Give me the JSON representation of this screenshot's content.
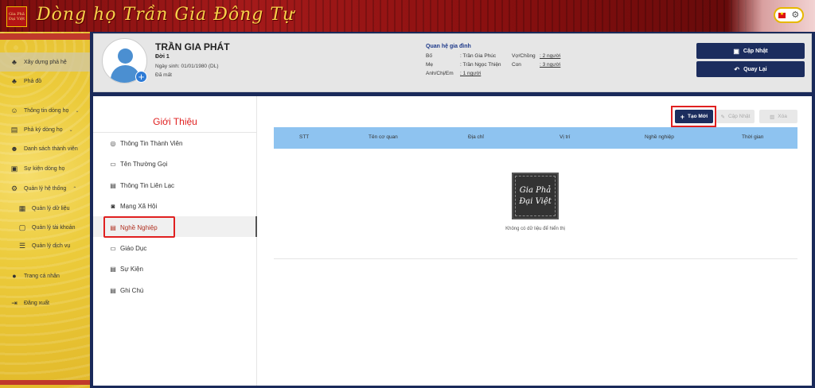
{
  "header": {
    "logo_text": "Gia Phả Đại Việt",
    "title": "Dòng họ Trần Gia Đông Tự"
  },
  "sidebar": {
    "items": [
      {
        "label": "Xây dựng phả hệ",
        "icon": "tree-icon"
      },
      {
        "label": "Phả đồ",
        "icon": "hierarchy-icon"
      },
      {
        "label": "Thông tin dòng họ",
        "icon": "family-icon"
      },
      {
        "label": "Phả ký dòng họ",
        "icon": "book-icon"
      },
      {
        "label": "Danh sách thành viên",
        "icon": "group-icon"
      },
      {
        "label": "Sự kiện dòng họ",
        "icon": "calendar-icon"
      },
      {
        "label": "Quản lý hệ thống",
        "icon": "settings-icon"
      },
      {
        "label": "Quản lý dữ liệu",
        "icon": "database-icon"
      },
      {
        "label": "Quản lý tài khoản",
        "icon": "account-icon"
      },
      {
        "label": "Quản lý dịch vụ",
        "icon": "list-icon"
      },
      {
        "label": "Trang cá nhân",
        "icon": "person-icon"
      },
      {
        "label": "Đăng xuất",
        "icon": "logout-icon"
      }
    ]
  },
  "profile": {
    "name": "TRẦN GIA PHÁT",
    "generation": "Đời 1",
    "birth": "Ngày sinh:  01/01/1980 (DL)",
    "status": "Đã mất",
    "relations": {
      "title": "Quan hệ gia đình",
      "father_label": "Bố",
      "father_value": ": Trần Gia Phúc",
      "mother_label": "Mẹ",
      "mother_value": ": Trần Ngọc Thiện",
      "siblings_label": "Anh/Chị/Em",
      "siblings_value": ": 1 người",
      "spouse_label": "Vợ/Chồng",
      "spouse_value": ": 2 người",
      "children_label": "Con",
      "children_value": ": 3 người"
    },
    "update_button": "Cập Nhật",
    "back_button": "Quay Lại"
  },
  "intro": {
    "title": "Giới Thiệu",
    "menu": [
      {
        "label": "Thông Tin Thành Viên",
        "icon": "user-circle-icon"
      },
      {
        "label": "Tên Thường Gọi",
        "icon": "id-card-icon"
      },
      {
        "label": "Thông Tin Liên Lạc",
        "icon": "contact-icon"
      },
      {
        "label": "Mạng Xã Hội",
        "icon": "instagram-icon"
      },
      {
        "label": "Nghề Nghiệp",
        "icon": "document-icon",
        "active": true
      },
      {
        "label": "Giáo Dục",
        "icon": "id-card-icon"
      },
      {
        "label": "Sự Kiện",
        "icon": "document-icon"
      },
      {
        "label": "Ghi Chú",
        "icon": "document-icon"
      }
    ]
  },
  "table": {
    "create_button": "Tạo Mới",
    "update_button": "Cập Nhật",
    "delete_button": "Xóa",
    "columns": [
      "STT",
      "Tên cơ quan",
      "Địa chỉ",
      "Vị trí",
      "Nghề nghiệp",
      "Thời gian"
    ],
    "empty_logo_text": "Gia Phả Đại Việt",
    "empty_text": "Không có dữ liệu để hiển thị"
  },
  "colors": {
    "accent": "#1c2d5e",
    "highlight": "#e02020",
    "table_header": "#8ec3f0"
  }
}
